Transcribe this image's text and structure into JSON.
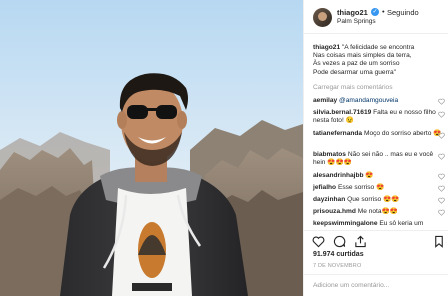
{
  "header": {
    "username": "thiago21",
    "separator": "•",
    "follow_status": "Seguindo",
    "location": "Palm Springs",
    "more_symbol": "···"
  },
  "caption": {
    "username": "thiago21",
    "lines": [
      "\"A felicidade se encontra",
      "Nas coisas mais simples da terra,",
      "Às vezes a paz de um sorriso",
      "Pode desarmar uma guerra\""
    ]
  },
  "load_more": "Carregar mais comentários",
  "comments": [
    {
      "user": "aemilay",
      "text": "",
      "mention": "@amandamgouveia"
    },
    {
      "user": "silvia.bernal.71619",
      "text": "Falta eu e nosso filho nesta foto! 😉",
      "mention": ""
    },
    {
      "user": "tatianefernanda",
      "text": "Moço do sorriso aberto 😍",
      "mention": ""
    },
    {
      "user": "biabmatos",
      "text": "Não sei não .. mas eu e você hein 😍😍😍",
      "mention": ""
    },
    {
      "user": "alesandrinhajbb",
      "text": "😍",
      "mention": ""
    },
    {
      "user": "jefialho",
      "text": "Esse sorriso 😍",
      "mention": ""
    },
    {
      "user": "dayzinhan",
      "text": "Que sorriso 😍😍",
      "mention": ""
    },
    {
      "user": "prisouza.hmd",
      "text": "Me nota😍😍",
      "mention": ""
    },
    {
      "user": "keepswimmingalone",
      "text": "Eu sô keria um",
      "mention": ""
    }
  ],
  "likes": "91.974 curtidas",
  "date": "7 DE NOVEMBRO",
  "add_comment_placeholder": "Adicione um comentário...",
  "colors": {
    "link": "#003569",
    "verified": "#3897f0",
    "muted": "#999999",
    "border": "#efefef"
  },
  "icons": [
    "heart-icon",
    "comment-icon",
    "share-icon",
    "bookmark-icon",
    "verified-icon"
  ]
}
